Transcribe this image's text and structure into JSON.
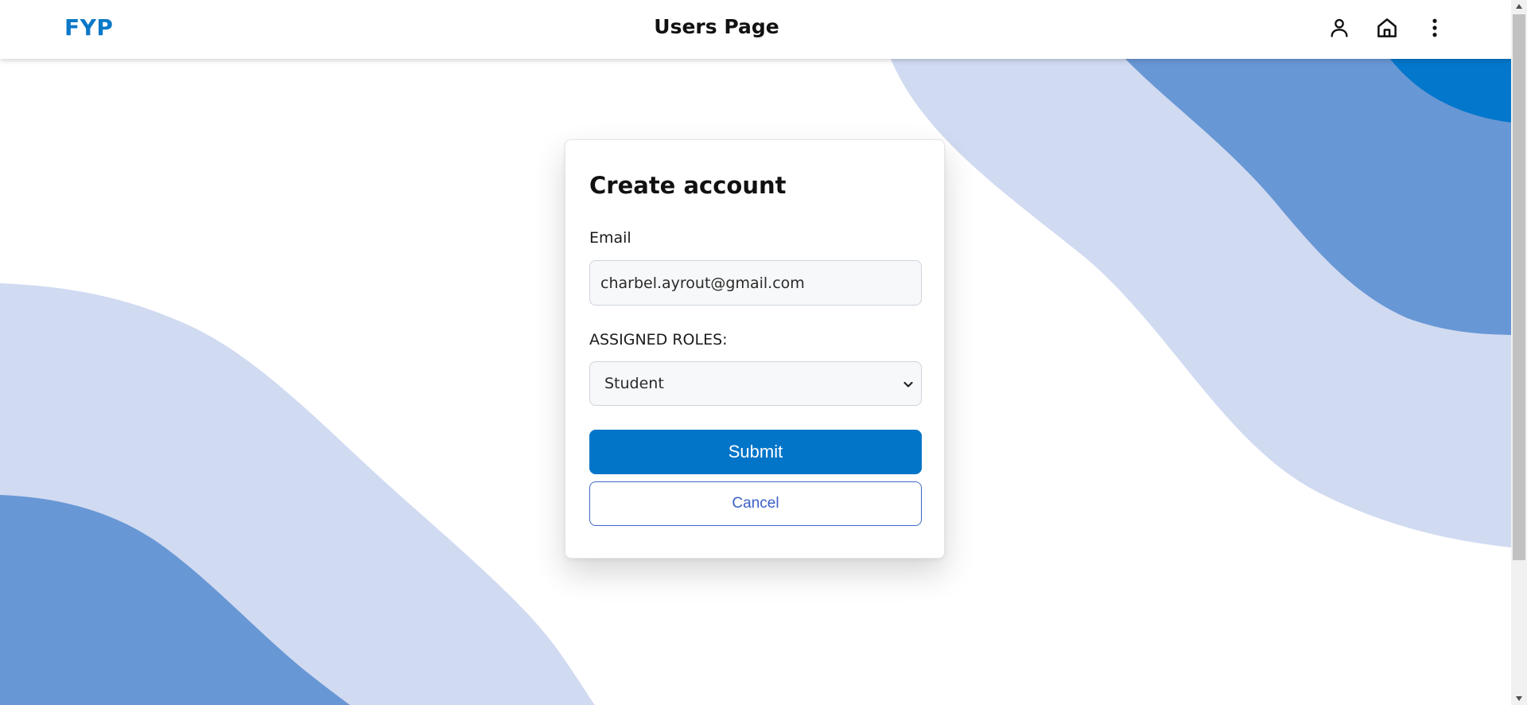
{
  "header": {
    "brand": "FYP",
    "title": "Users Page",
    "icons": [
      "user-icon",
      "home-icon",
      "more-vertical-icon"
    ]
  },
  "form": {
    "title": "Create account",
    "email_label": "Email",
    "email_value": "charbel.ayrout@gmail.com",
    "roles_label": "ASSIGNED ROLES:",
    "roles_selected": "Student",
    "submit_label": "Submit",
    "cancel_label": "Cancel"
  },
  "theme": {
    "brand_color": "#0b78c8",
    "primary_button": "#0275c9",
    "cancel_border": "#3f68c9",
    "wave_light": "#d0daf1",
    "wave_mid": "#6897d5",
    "wave_dark": "#0277cb"
  }
}
